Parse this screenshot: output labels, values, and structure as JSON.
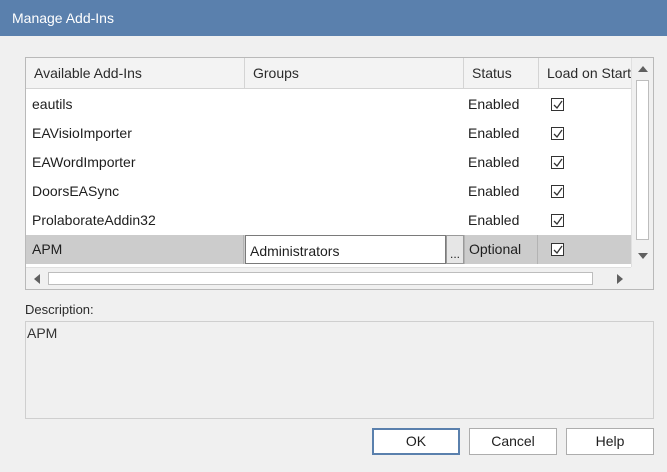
{
  "window": {
    "title": "Manage Add-Ins"
  },
  "grid": {
    "columns": [
      "Available Add-Ins",
      "Groups",
      "Status",
      "Load on Start"
    ],
    "rows": [
      {
        "name": "eautils",
        "group": "",
        "status": "Enabled",
        "load": true
      },
      {
        "name": "EAVisioImporter",
        "group": "",
        "status": "Enabled",
        "load": true
      },
      {
        "name": "EAWordImporter",
        "group": "",
        "status": "Enabled",
        "load": true
      },
      {
        "name": "DoorsEASync",
        "group": "",
        "status": "Enabled",
        "load": true
      },
      {
        "name": "ProlaborateAddin32",
        "group": "",
        "status": "Enabled",
        "load": true
      },
      {
        "name": "APM",
        "group": "Administrators",
        "status": "Optional",
        "load": true,
        "selected": true
      }
    ],
    "ellipsis": "..."
  },
  "description": {
    "label": "Description:",
    "text": "APM"
  },
  "buttons": {
    "ok": "OK",
    "cancel": "Cancel",
    "help": "Help"
  },
  "colors": {
    "titlebar": "#5a80ad",
    "selected_row": "#cccccc"
  }
}
